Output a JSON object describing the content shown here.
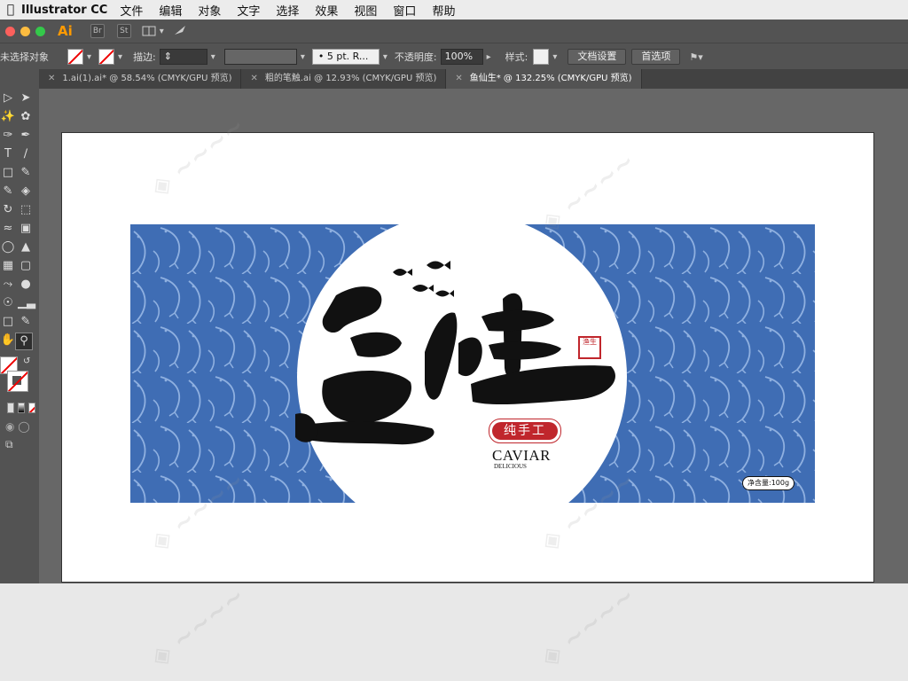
{
  "menubar": {
    "apple_icon": "apple-icon",
    "app_name": "Illustrator CC",
    "items": [
      "文件",
      "编辑",
      "对象",
      "文字",
      "选择",
      "效果",
      "视图",
      "窗口",
      "帮助"
    ]
  },
  "appbar": {
    "logo": "Ai",
    "bridge": "Br",
    "stock": "St"
  },
  "control": {
    "selection_label": "未选择对象",
    "stroke_label": "描边:",
    "brush_value": "5 pt. R...",
    "opacity_label": "不透明度:",
    "opacity_value": "100%",
    "style_label": "样式:",
    "doc_setup": "文档设置",
    "preferences": "首选项"
  },
  "tabs": [
    {
      "label": "1.ai(1).ai* @ 58.54% (CMYK/GPU 预览)",
      "active": false
    },
    {
      "label": "粗的笔触.ai @ 12.93% (CMYK/GPU 预览)",
      "active": false
    },
    {
      "label": "鱼仙生* @ 132.25% (CMYK/GPU 预览)",
      "active": true
    }
  ],
  "artwork": {
    "title_calligraphy": "鱼仙生",
    "seal": "渔生",
    "badge": "纯手工",
    "caviar": "CAVIAR",
    "delicious": "DELICIOUS",
    "net_weight": "净含量:100g"
  },
  "colors": {
    "pattern_blue": "#3f6db4",
    "pattern_line": "#8fb0e0",
    "seal_red": "#c0262c",
    "accent_orange": "#ff9a00"
  }
}
